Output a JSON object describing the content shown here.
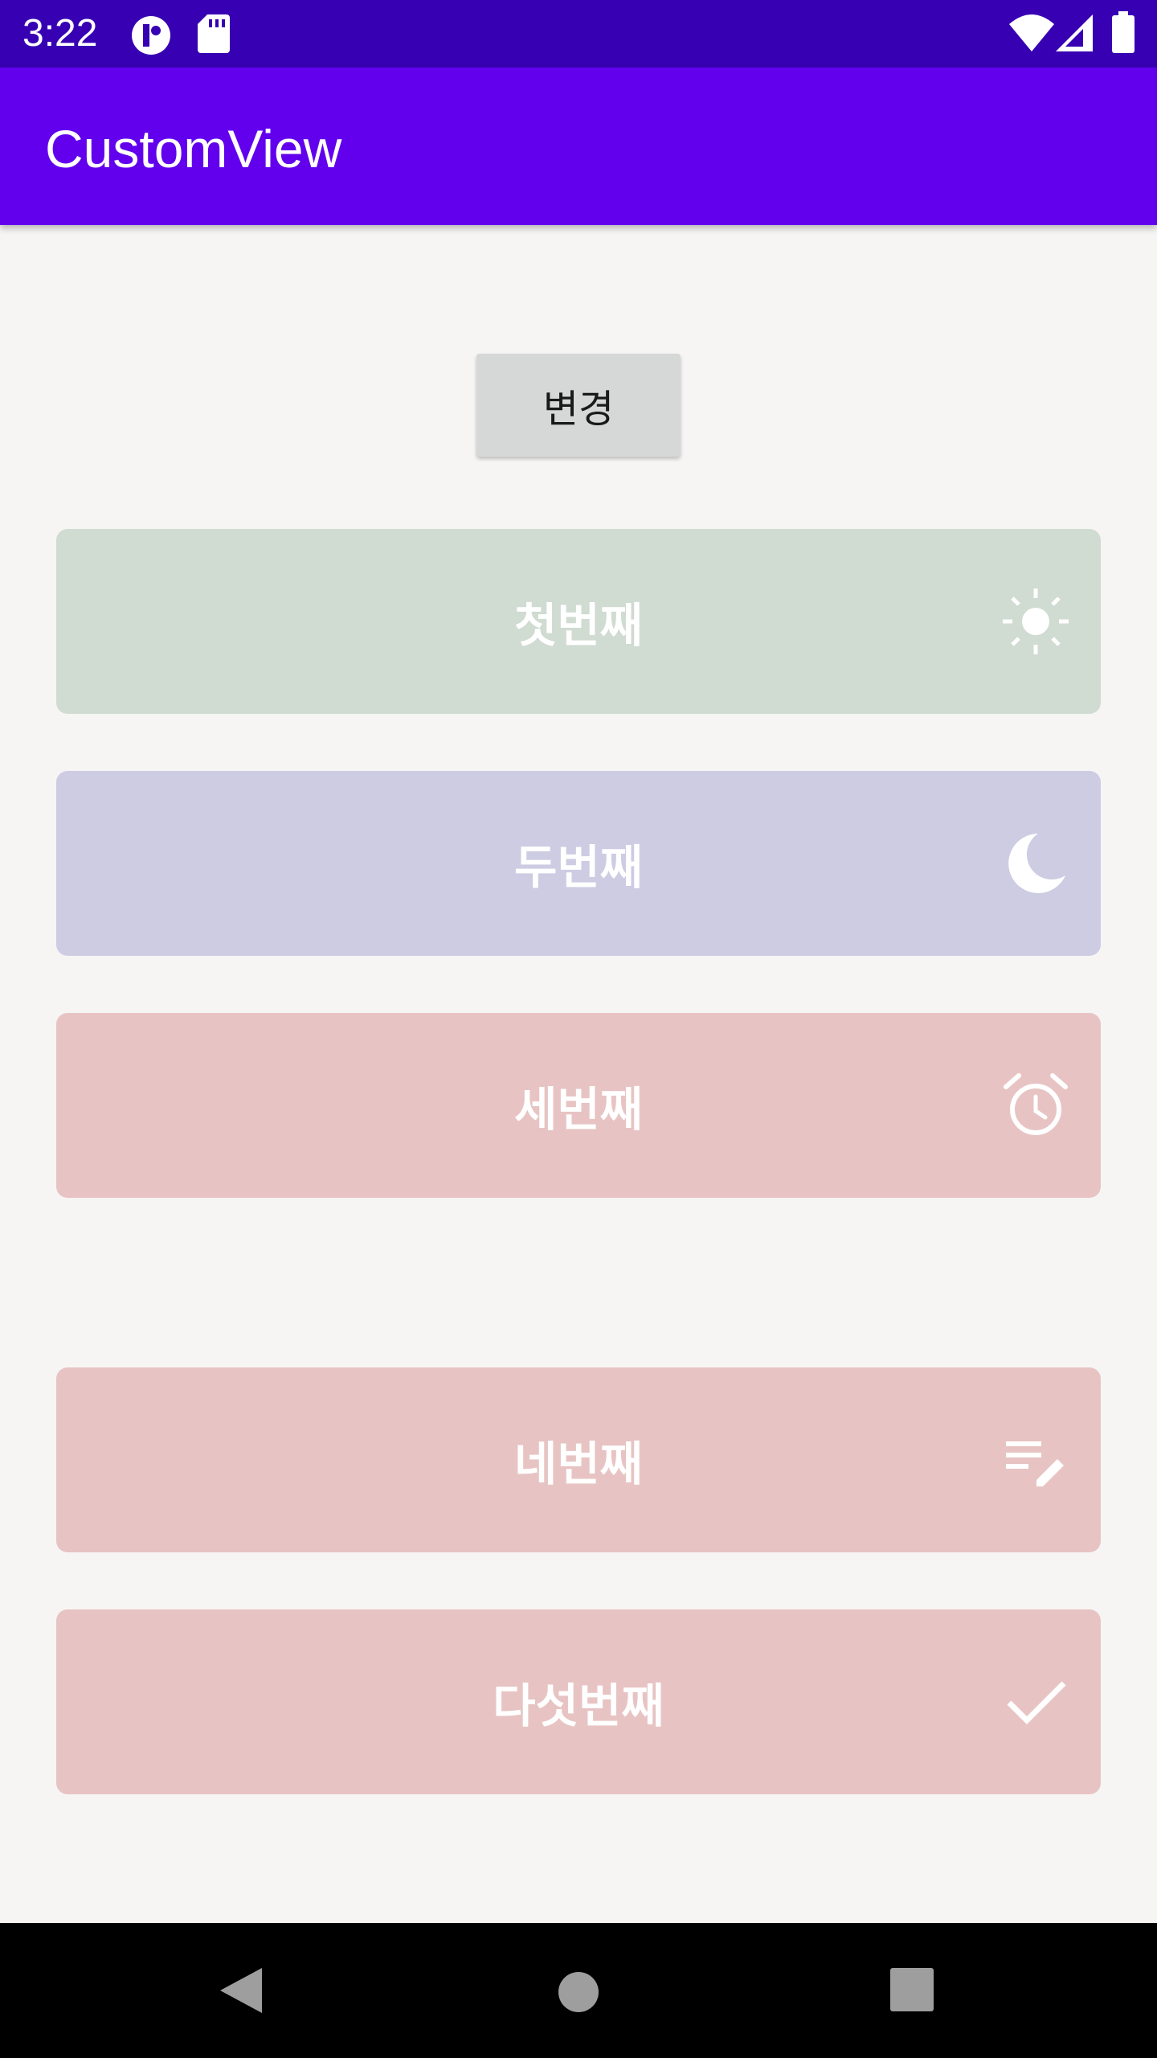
{
  "status_bar": {
    "time": "3:22",
    "icons": [
      "notification-app-icon",
      "sd-card-icon",
      "wifi-icon",
      "cellular-signal-icon",
      "battery-icon"
    ]
  },
  "app_bar": {
    "title": "CustomView",
    "color": "#6200ee",
    "status_color": "#3700b3"
  },
  "change_button": {
    "label": "변경"
  },
  "cards": [
    {
      "label": "첫번째",
      "icon": "sun-icon",
      "color": "#d0dbd2"
    },
    {
      "label": "두번째",
      "icon": "moon-icon",
      "color": "#cdcce3"
    },
    {
      "label": "세번째",
      "icon": "alarm-icon",
      "color": "#e7c4c3"
    },
    {
      "label": "네번째",
      "icon": "edit-note-icon",
      "color": "#e7c4c3"
    },
    {
      "label": "다섯번째",
      "icon": "check-icon",
      "color": "#e7c4c3"
    }
  ],
  "nav_bar": {
    "buttons": [
      "back-icon",
      "home-icon",
      "recents-icon"
    ]
  }
}
